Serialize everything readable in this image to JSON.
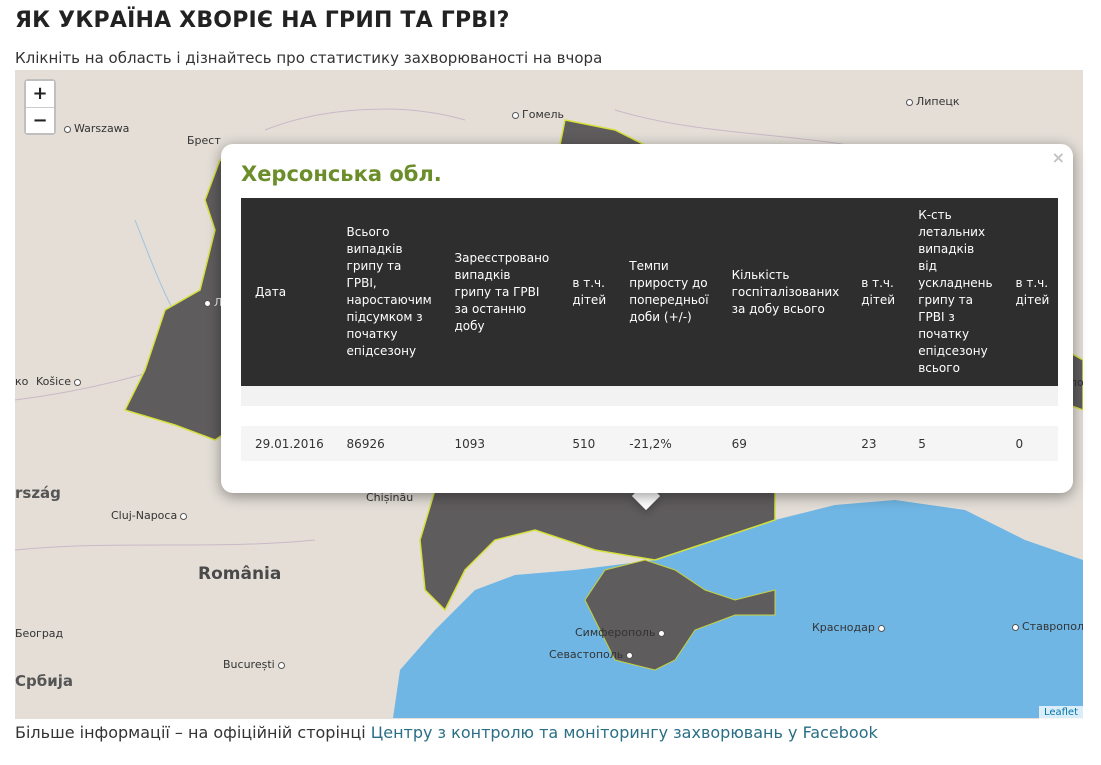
{
  "page": {
    "title": "ЯК УКРАЇНА ХВОРІЄ НА ГРИП ТА ГРВІ?",
    "subtitle": "Клікніть на область і дізнайтесь про статистику захворюваності на вчора"
  },
  "map": {
    "zoom_in": "+",
    "zoom_out": "−",
    "attribution": "Leaflet",
    "colors": {
      "land": "#e4ded7",
      "sea": "#70b6e4",
      "region_fill": "#5f5c5d",
      "region_border": "#d6e03a"
    },
    "cities": {
      "warszawa": "Warszawa",
      "brest": "Брест",
      "gomel": "Гомель",
      "lipetsk": "Липецк",
      "lviv": "Льв",
      "kosice": "Košice",
      "ko": "ко",
      "rszag": "rszág",
      "cluj": "Cluj-Napoca",
      "chisinau": "Chișinău",
      "romania": "România",
      "beograd": "Београд",
      "bucuresti": "București",
      "srbija": "Србија",
      "simferopol": "Симферополь",
      "sevastopol": "Севастополь",
      "krasnodar": "Краснодар",
      "stavropol": "Ставрополь",
      "right_lo": "ло"
    }
  },
  "popup": {
    "close": "×",
    "region": "Херсонська обл.",
    "columns": [
      "Дата",
      "Всього випадків грипу та ГРВІ, наростаючим підсумком з початку епідсезону",
      "Зареєстровано випадків грипу та ГРВІ за останню добу",
      "в т.ч. дітей",
      "Темпи приросту до попередньої доби (+/-)",
      "Кількість госпіталізованих за добу всього",
      "в т.ч. дітей",
      "К-сть летальних випадків від ускладнень грипу та ГРВІ з початку епідсезону всього",
      "в т.ч. дітей"
    ],
    "row": [
      "29.01.2016",
      "86926",
      "1093",
      "510",
      "-21,2%",
      "69",
      "23",
      "5",
      "0"
    ]
  },
  "footer": {
    "text": "Більше інформації – на офіційній сторінці ",
    "link": "Центру з контролю та моніторингу захворювань у Facebook"
  }
}
